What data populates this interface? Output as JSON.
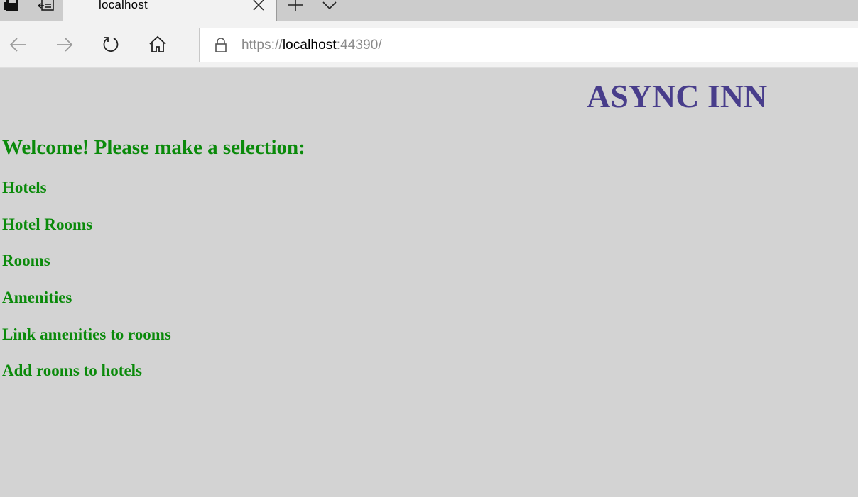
{
  "browser": {
    "tab_title": "localhost",
    "url_scheme": "https://",
    "url_host": "localhost",
    "url_rest": ":44390/"
  },
  "page": {
    "brand": "ASYNC INN",
    "welcome": "Welcome! Please make a selection:",
    "menu": [
      {
        "label": "Hotels"
      },
      {
        "label": "Hotel Rooms"
      },
      {
        "label": "Rooms"
      },
      {
        "label": "Amenities"
      },
      {
        "label": "Link amenities to rooms"
      },
      {
        "label": "Add rooms to hotels"
      }
    ]
  },
  "colors": {
    "page_background": "#d3d3d3",
    "brand": "#483d8b",
    "text_green": "#0a8a0a"
  }
}
